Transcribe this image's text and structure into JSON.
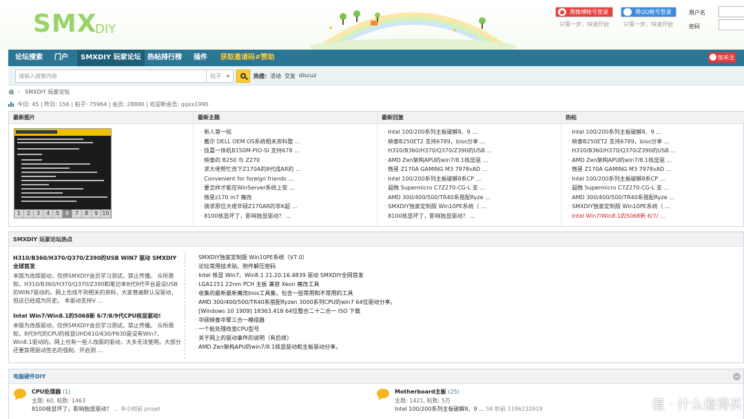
{
  "header": {
    "logo_main": "SMX",
    "logo_sub": "DIY",
    "weibo_login": "用微博帐号登录",
    "qq_login": "用QQ帐号登录",
    "weibo_hint": "只需一步，快速开始",
    "qq_hint": "只需一步，快速开始",
    "username_label": "用户名",
    "password_label": "密码"
  },
  "nav": {
    "items": [
      "论坛搜索",
      "门户",
      "SMXDIY 玩家论坛",
      "热帖排行榜",
      "插件",
      "获取邀请码#赞助"
    ],
    "active_index": 2,
    "follow_label": "加关注"
  },
  "search": {
    "placeholder": "请输入搜索内容",
    "type_selected": "帖子",
    "hot_label": "热搜:",
    "hot_keywords": [
      "活动",
      "交友",
      "discuz"
    ]
  },
  "breadcrumb": {
    "separator": "›",
    "current": "SMXDIY 玩家论坛"
  },
  "stats": {
    "text": "今日: 45 | 昨日: 156 | 帖子: 75964 | 会员: 28880 | 欢迎新会员: qqxx1990"
  },
  "grid": {
    "headers": [
      "最新图片",
      "最新主题",
      "最新回复",
      "热帖"
    ],
    "thumb_pager": [
      "1",
      "2",
      "3",
      "4",
      "5",
      "6",
      "7",
      "8",
      "9",
      "10"
    ],
    "thumb_pager_active": 5,
    "new_topics": [
      "新人第一帖",
      "戴尔 DELL OEM OS系统相关资料整 ...",
      "技嘉一体机B150M-PIO-SI 支持678 ...",
      "映泰的 B250 与 Z270",
      "求大佬帮忙改下Z170A的8代成AR的 ...",
      "Convenient for foreign friends ...",
      "要怎样才能在WinServer系统上安 ...",
      "微星z170 m7 魔改",
      "骑求那位大佬华硕Z170AR的非K超 ...",
      "8100核显坏了，影响独显驱动？ ..."
    ],
    "new_replies": [
      "Intel 100/200系列主板破解8、9 ...",
      "映泰B250ET2 支持6789，bios分享 ...",
      "H310/B360/H370/Q370/Z390的USB ...",
      "AMD Zen架构APU的win7/8.1核显驱 ...",
      "微星 Z170A GAMING M3 7978vAD ...",
      "Intel 100/200系列主板破解8系CP ...",
      "超微 Supermicro C7Z270-CG-L 支 ...",
      "AMD 300/400/500/TR40系搭配Ryze ...",
      "SMXDIY独家定制版 Win10PE系统（ ...",
      "8100核显坏了，影响独显驱动？ ..."
    ],
    "hot_posts": [
      "Intel 100/200系列主板破解8、9 ...",
      "映泰B250ET2 支持6789，bios分享 ...",
      "H310/B360/H370/Q370/Z390的USB ...",
      "AMD Zen架构APU的win7/8.1核显驱 ...",
      "微星 Z170A GAMING M3 7978vAD ...",
      "Intel 100/200系列主板破解8系CP ...",
      "超微 Supermicro C7Z270-CG-L 支 ...",
      "AMD 300/400/500/TR40系搭配Ryze ...",
      "SMXDIY独家定制版 Win10PE系统（ ...",
      "Intel Win7/Win8.1的5068新 6/7/ ..."
    ],
    "highlight_color": "#d61e1e"
  },
  "hot_section": {
    "title": "SMXDIY 玩家论坛热点",
    "features": [
      {
        "title": "H310/B360/H370/Q370/Z390的USB WIN7 驱动 SMXDIY全球首发",
        "summary": "本版为改版驱动，仅供SMXDIY会员学习测试，禁止传播。 众所周知，H310/B360/H370/Q370/Z390和笔记本8代9代平台是没USB的WIN7驱动的。网上也找不到相关的资料，大家普遍默认没驱动，但这已经成为历史。 本驱动支持V ..."
      },
      {
        "title": "Intel Win7/Win8.1的5068新 6/7/8/9代CPU核显驱动!",
        "summary": "本版为改版驱动，仅供SMXDIY会员学习测试，禁止传播。 众所周知，8代9代的CPU的核显UHD610/630/P630是没有Win7、Win8.1驱动的。网上也有一些人改版的驱动，大多无法使用。大部分还要禁用驱动签名的强制、开启测 ..."
      }
    ],
    "list": [
      "SMXDIY独家定制版 Win10PE系统（V7.0）",
      "论坛常用技术贴、附件解压密码",
      "Intel 核显 Win7、Win8.1 21.20.16.4839 驱动 SMXDIY全网首发",
      "LGA1151 22nm PCH 主板 兼容 Xeon 魔改工具",
      "收集的最新最新魔改bios工具集，包含一些常用和不常用的工具",
      "AMD 300/400/500/TR40系搭配Ryzen 3000系列CPU的win7 64位驱动分享。",
      "[Windows 10 1909] 18363.418 64位整合二十二合一 ISO 下载",
      "华硕映泰华擎三合一模组器",
      "一个批处理改变CPU型号",
      "关于网上的驱动事件的说明（有后续）",
      "AMD Zen架构APU的win7/8.1核显驱动和主板驱动分享。"
    ]
  },
  "category": {
    "title": "电脑硬件DIY",
    "forums": [
      {
        "name": "CPU处理器",
        "count": "(1)",
        "stats": "主题: 60, 帖数: 1463",
        "last_post": "8100核显坏了，影响独显驱动？",
        "last_meta": "... 半小时前 projet"
      },
      {
        "name": "Motherboard主板",
        "count": "(25)",
        "stats": "主题: 1421, 帖数: 5万",
        "last_post": "Intel 100/200系列主板破解8、9 ...",
        "last_meta": "58 秒前 1196232919"
      }
    ]
  },
  "watermark": {
    "text": "值 · 什么值得买"
  },
  "colors": {
    "nav_bg": "#2b7694",
    "logo_green": "#9ad36a",
    "accent_yellow": "#ffcc33",
    "weibo_red": "#e8403d",
    "qq_blue": "#3b8be0"
  }
}
